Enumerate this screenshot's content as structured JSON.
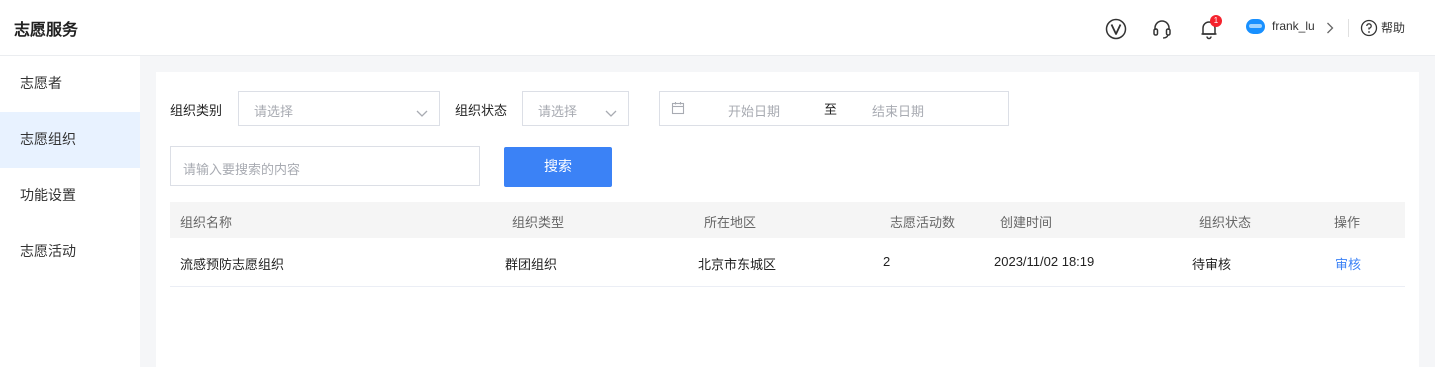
{
  "app": {
    "title": "志愿服务"
  },
  "header": {
    "notification_count": "1",
    "username": "frank_lu",
    "help_label": "帮助",
    "icons": [
      "v-logo-icon",
      "headset-icon",
      "bell-icon",
      "avatar",
      "chevron-right-icon",
      "help-circle-icon"
    ]
  },
  "sidebar": {
    "items": [
      {
        "label": "志愿者",
        "active": false
      },
      {
        "label": "志愿组织",
        "active": true
      },
      {
        "label": "功能设置",
        "active": false
      },
      {
        "label": "志愿活动",
        "active": false
      }
    ]
  },
  "filters": {
    "org_type_label": "组织类别",
    "org_type_placeholder": "请选择",
    "org_status_label": "组织状态",
    "org_status_placeholder": "请选择",
    "start_date_placeholder": "开始日期",
    "range_separator": "至",
    "end_date_placeholder": "结束日期",
    "search_placeholder": "请输入要搜索的内容",
    "search_button": "搜索"
  },
  "table": {
    "columns": [
      "组织名称",
      "组织类型",
      "所在地区",
      "志愿活动数",
      "创建时间",
      "组织状态",
      "操作"
    ],
    "rows": [
      {
        "name": "流感预防志愿组织",
        "type": "群团组织",
        "region": "北京市东城区",
        "activity_count": "2",
        "created_at": "2023/11/02 18:19",
        "status": "待审核",
        "action": "审核"
      }
    ]
  },
  "colors": {
    "accent": "#3b82f6",
    "active_nav_bg": "#e8f2ff",
    "badge": "#f5222d"
  }
}
